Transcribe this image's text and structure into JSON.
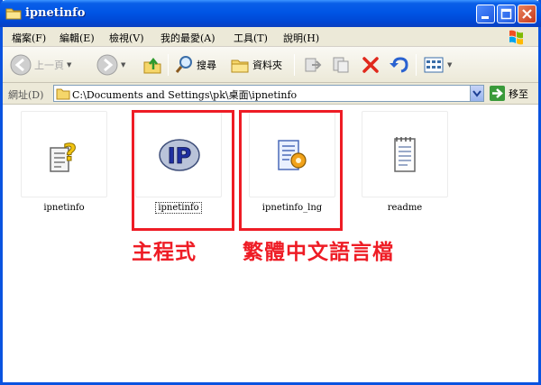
{
  "window": {
    "title": "ipnetinfo"
  },
  "menu": [
    {
      "label": "檔案(F)"
    },
    {
      "label": "編輯(E)"
    },
    {
      "label": "檢視(V)"
    },
    {
      "label": "我的最愛(A)"
    },
    {
      "label": "工具(T)"
    },
    {
      "label": "說明(H)"
    }
  ],
  "toolbar": {
    "back_label": "上一頁",
    "search_label": "搜尋",
    "folders_label": "資料夾"
  },
  "address": {
    "label": "網址(D)",
    "value": "C:\\Documents and Settings\\pk\\桌面\\ipnetinfo",
    "go_label": "移至"
  },
  "files": [
    {
      "name": "ipnetinfo",
      "icon": "unknown-file-icon"
    },
    {
      "name": "ipnetinfo",
      "icon": "ip-app-icon",
      "focused": true
    },
    {
      "name": "ipnetinfo_lng",
      "icon": "config-file-icon"
    },
    {
      "name": "readme",
      "icon": "text-file-icon"
    }
  ],
  "annotations": {
    "main_program": "主程式",
    "language_file": "繁體中文語言檔"
  },
  "colors": {
    "titlebar": "#0055e5",
    "highlight": "#ee1c25"
  }
}
